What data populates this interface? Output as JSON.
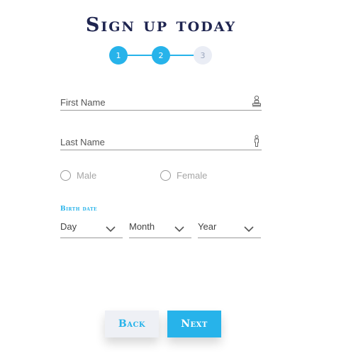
{
  "title": "Sign up today",
  "stepper": {
    "steps": [
      {
        "label": "1",
        "state": "completed"
      },
      {
        "label": "2",
        "state": "active"
      },
      {
        "label": "3",
        "state": "inactive"
      }
    ],
    "current_step": 2
  },
  "form": {
    "first_name": {
      "placeholder": "First Name",
      "value": "",
      "icon": "person-bust-icon"
    },
    "last_name": {
      "placeholder": "Last Name",
      "value": "",
      "icon": "person-standing-icon"
    },
    "gender": {
      "options": [
        {
          "label": "Male",
          "selected": false
        },
        {
          "label": "Female",
          "selected": false
        }
      ]
    },
    "birth_date": {
      "label": "Birth date",
      "day": "Day",
      "month": "Month",
      "year": "Year"
    }
  },
  "buttons": {
    "back": "Back",
    "next": "Next"
  },
  "colors": {
    "accent": "#27b3ea",
    "title": "#1f2550",
    "inactive_step_bg": "#eaedf5",
    "inactive_step_text": "#9ba6bd",
    "back_button_bg": "#eef0f5"
  }
}
